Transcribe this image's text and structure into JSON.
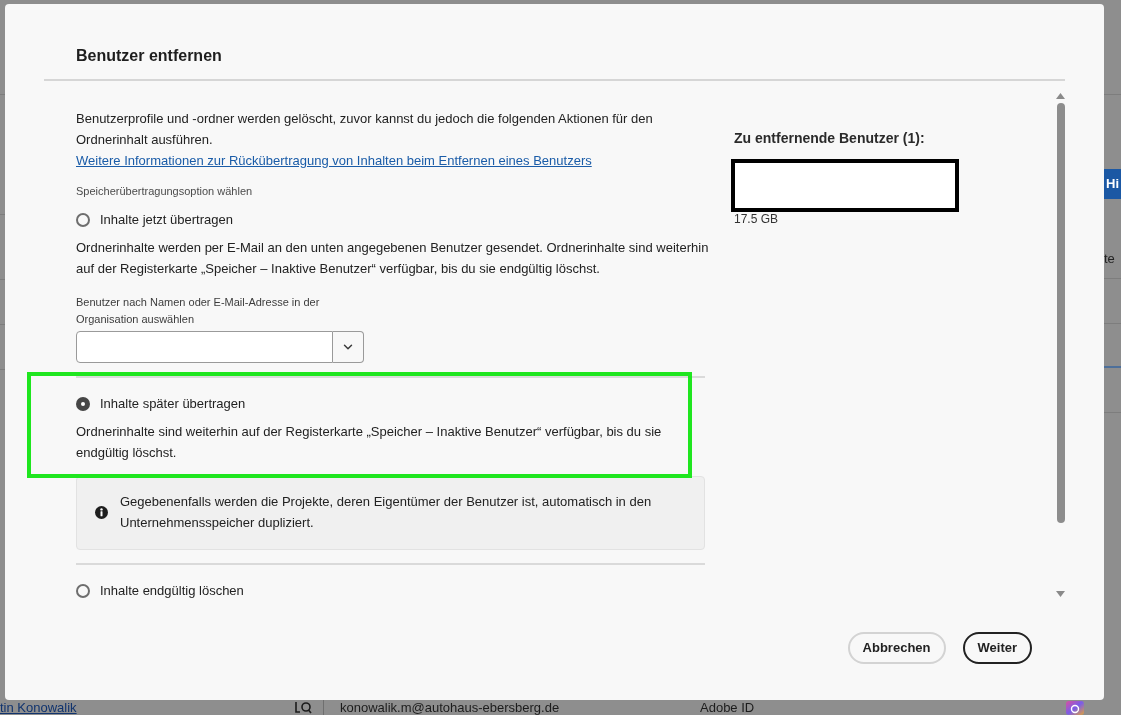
{
  "background_page": {
    "side_button": "Hi",
    "side_text": "te",
    "row": {
      "name": "tin Konowalik",
      "email": "konowalik.m@autohaus-ebersberg.de",
      "account_type": "Adobe ID"
    }
  },
  "dialog": {
    "title": "Benutzer entfernen",
    "intro": "Benutzerprofile und -ordner werden gelöscht, zuvor kannst du jedoch die folgenden Aktionen für den Ordnerinhalt ausführen.",
    "info_link": "Weitere Informationen zur Rückübertragung von Inhalten beim Entfernen eines Benutzers",
    "option_label": "Speicherübertragungsoption wählen",
    "options": [
      {
        "label": "Inhalte jetzt übertragen",
        "selected": false,
        "highlighted": false,
        "description": "Ordnerinhalte werden per E-Mail an den unten angegebenen Benutzer gesendet. Ordnerinhalte sind weiterhin auf der Registerkarte „Speicher – Inaktive Benutzer“ verfügbar, bis du sie endgültig löschst.",
        "user_picker": {
          "label": "Benutzer nach Namen oder E-Mail-Adresse in der Organisation auswählen"
        }
      },
      {
        "label": "Inhalte später übertragen",
        "selected": true,
        "highlighted": true,
        "description": "Ordnerinhalte sind weiterhin auf der Registerkarte „Speicher – Inaktive Benutzer“ verfügbar, bis du sie endgültig löschst.",
        "notice": "Gegebenenfalls werden die Projekte, deren Eigentümer der Benutzer ist, automatisch in den Unternehmensspeicher dupliziert."
      },
      {
        "label": "Inhalte endgültig löschen",
        "selected": false,
        "highlighted": false
      }
    ],
    "users_heading": "Zu entfernende Benutzer (1):",
    "users": [
      {
        "size": "17.5 GB"
      }
    ],
    "buttons": [
      {
        "label": "Abbrechen",
        "kind": "secondary"
      },
      {
        "label": "Weiter",
        "kind": "primary"
      }
    ]
  }
}
